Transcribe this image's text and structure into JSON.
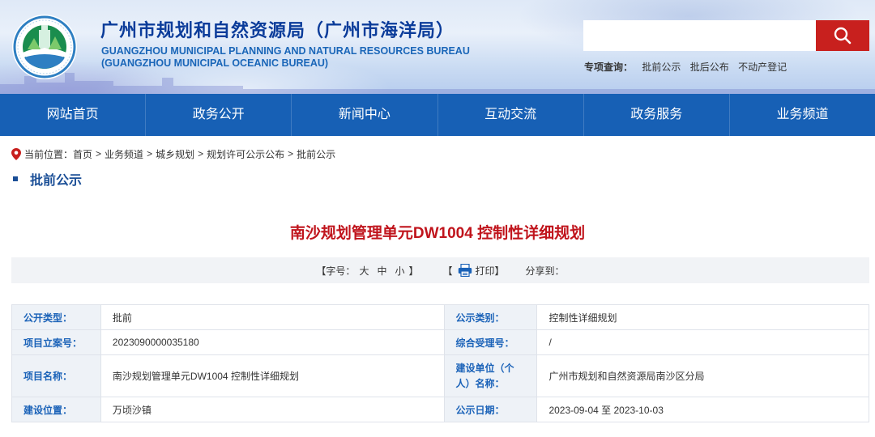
{
  "header": {
    "title_cn": "广州市规划和自然资源局（广州市海洋局）",
    "title_en_1": "GUANGZHOU MUNICIPAL PLANNING AND NATURAL RESOURCES BUREAU",
    "title_en_2": "(GUANGZHOU MUNICIPAL OCEANIC BUREAU)",
    "logo_icon": "bureau-emblem-icon",
    "search": {
      "placeholder": "",
      "icon": "search-icon",
      "button_color": "#c8201e"
    },
    "quick_links": {
      "label": "专项查询：",
      "items": [
        "批前公示",
        "批后公布",
        "不动产登记"
      ]
    }
  },
  "nav": {
    "items": [
      "网站首页",
      "政务公开",
      "新闻中心",
      "互动交流",
      "政务服务",
      "业务频道"
    ],
    "color": "#1760b5"
  },
  "breadcrumb": {
    "label": "当前位置：",
    "items": [
      "首页",
      "业务频道",
      "城乡规划",
      "规划许可公示公布",
      "批前公示"
    ],
    "separator": ">"
  },
  "section": {
    "title": "批前公示"
  },
  "article": {
    "title": "南沙规划管理单元DW1004 控制性详细规划",
    "title_color": "#c0141c"
  },
  "toolbar": {
    "font_label_open": "【字号：",
    "font_large": "大",
    "font_medium": "中",
    "font_small": "小",
    "font_label_close": "】",
    "print_open": "【",
    "print_label": "打印",
    "print_close": "】",
    "share_label": "分享到："
  },
  "info": {
    "labels": {
      "open_type": "公开类型：",
      "publicity_type": "公示类别：",
      "project_no": "项目立案号：",
      "comprehensive_no": "综合受理号：",
      "project_name": "项目名称：",
      "builder": "建设单位（个人）名称：",
      "location": "建设位置：",
      "date": "公示日期："
    },
    "values": {
      "open_type": "批前",
      "publicity_type": "控制性详细规划",
      "project_no": "2023090000035180",
      "comprehensive_no": "/",
      "project_name": "南沙规划管理单元DW1004 控制性详细规划",
      "builder": "广州市规划和自然资源局南沙区分局",
      "location": "万顷沙镇",
      "date": "2023-09-04 至 2023-10-03"
    }
  }
}
